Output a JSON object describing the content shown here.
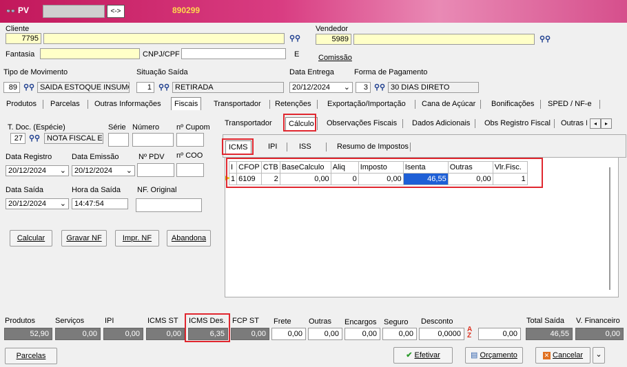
{
  "title_bar": {
    "app_label": "PV",
    "toggle_label": "<->",
    "doc_number": "890299"
  },
  "cliente": {
    "label": "Cliente",
    "code": "7795",
    "name": ""
  },
  "fantasia": {
    "label": "Fantasia",
    "value": ""
  },
  "cnpj": {
    "label": "CNPJ/CPF",
    "value": "",
    "suffix": "E"
  },
  "vendedor": {
    "label": "Vendedor",
    "code": "5989",
    "name": ""
  },
  "comissao": {
    "label": "Comissão"
  },
  "movimento": {
    "label": "Tipo  de Movimento",
    "code": "89",
    "desc": "SAIDA ESTOQUE INSUMO"
  },
  "situacao": {
    "label": "Situação Saída",
    "code": "1",
    "desc": "RETIRADA"
  },
  "data_entrega": {
    "label": "Data Entrega",
    "value": "20/12/2024"
  },
  "pagamento": {
    "label": "Forma de Pagamento",
    "code": "3",
    "desc": "30 DIAS DIRETO"
  },
  "main_tabs": [
    "Produtos",
    "Parcelas",
    "Outras Informações",
    "Fiscais",
    "Transportador",
    "Retenções",
    "Exportação/Importação",
    "Cana de Açúcar",
    "Bonificações",
    "SPED / NF-e"
  ],
  "left": {
    "tdoc_label": "T. Doc. (Espécie)",
    "serie_label": "Série",
    "numero_label": "Número",
    "cupom_label": "nº Cupom",
    "tdoc_code": "27",
    "tdoc_desc": "NOTA FISCAL E",
    "data_registro_label": "Data Registro",
    "data_registro": "20/12/2024",
    "data_emissao_label": "Data Emissão",
    "data_emissao": "20/12/2024",
    "pdv_label": "Nº PDV",
    "coo_label": "nº COO",
    "data_saida_label": "Data Saída",
    "data_saida": "20/12/2024",
    "hora_saida_label": "Hora da Saída",
    "hora_saida": "14:47:54",
    "nf_original_label": "NF. Original",
    "buttons": {
      "calcular": "Calcular",
      "gravar": "Gravar NF",
      "impr": "Impr. NF",
      "abandona": "Abandona"
    }
  },
  "sub_tabs": [
    "Transportador",
    "Cálculo",
    "Observações Fiscais",
    "Dados Adicionais",
    "Obs Registro Fiscal",
    "Outras Info"
  ],
  "calc_tabs": [
    "ICMS",
    "IPI",
    "ISS",
    "Resumo de Impostos"
  ],
  "grid": {
    "columns": [
      "I",
      "CFOP",
      "CTB",
      "BaseCalculo",
      "Aliq",
      "Imposto",
      "Isenta",
      "Outras",
      "Vlr.Fisc."
    ],
    "rows": [
      [
        "1",
        "6109",
        "2",
        "0,00",
        "0",
        "0,00",
        "46,55",
        "0,00",
        "1"
      ]
    ]
  },
  "totals": {
    "labels": [
      "Produtos",
      "Serviços",
      "IPI",
      "ICMS ST",
      "ICMS Des.",
      "FCP ST",
      "Frete",
      "Outras",
      "Encargos",
      "Seguro",
      "Desconto",
      "Total Saída",
      "V. Financeiro"
    ],
    "produtos": "52,90",
    "servicos": "0,00",
    "ipi": "0,00",
    "icms_st": "0,00",
    "icms_des": "6,35",
    "fcp_st": "0,00",
    "frete": "0,00",
    "outras": "0,00",
    "encargos": "0,00",
    "seguro": "0,00",
    "desconto": "0,0000",
    "desconto_valor": "0,00",
    "total_saida": "46,55",
    "v_financeiro": "0,00"
  },
  "footer": {
    "parcelas": "Parcelas",
    "efetivar": "Efetivar",
    "orcamento": "Orçamento",
    "cancelar": "Cancelar"
  },
  "colors": {
    "title_gradient_start": "#c2185b",
    "highlight_red": "#e0262e",
    "selection_blue": "#1e5fd6"
  }
}
